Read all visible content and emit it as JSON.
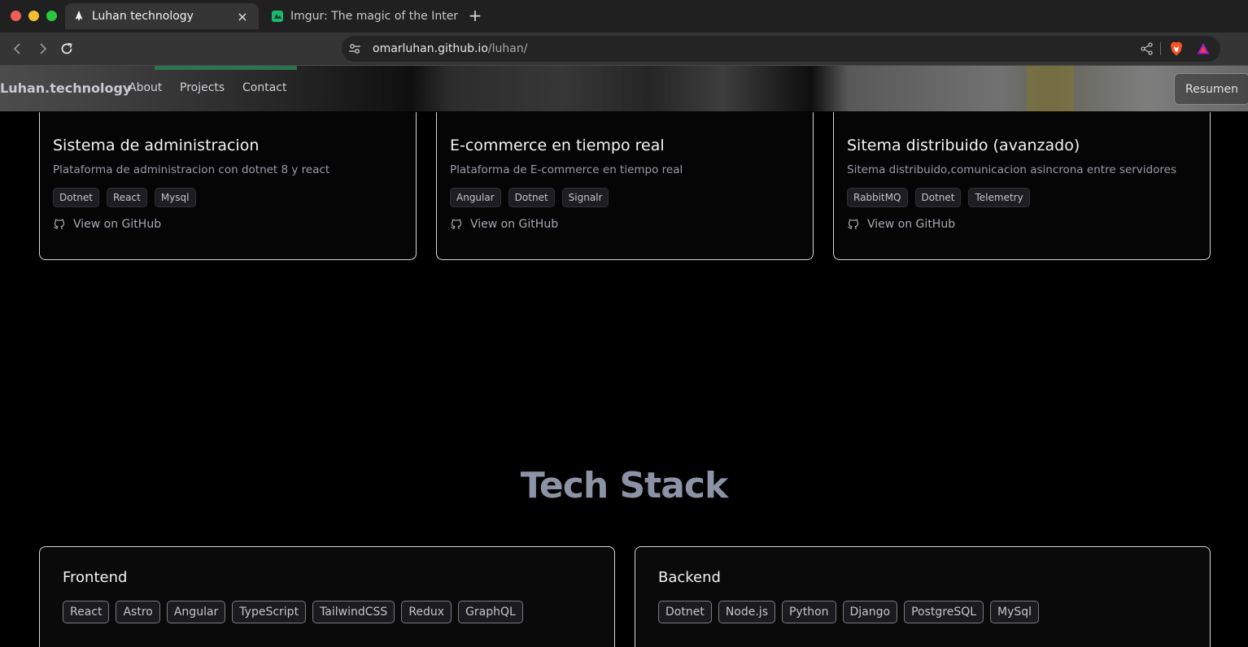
{
  "browser": {
    "tabs": [
      {
        "title": "Luhan technology",
        "active": true
      },
      {
        "title": "Imgur: The magic of the Inter",
        "active": false
      }
    ],
    "close_glyph": "×",
    "newtab_glyph": "+",
    "url_domain": "omarluhan.github.io",
    "url_path": "/luhan/"
  },
  "header": {
    "brand": "Luhan.technology",
    "nav": [
      "About",
      "Projects",
      "Contact"
    ],
    "resume_label": "Resumen"
  },
  "projects": [
    {
      "title": "Sistema de administracion",
      "description": "Plataforma de administracion con dotnet 8 y react",
      "tags": [
        "Dotnet",
        "React",
        "Mysql"
      ],
      "link": "View on GitHub"
    },
    {
      "title": "E-commerce en tiempo real",
      "description": "Plataforma de E-commerce en tiempo real",
      "tags": [
        "Angular",
        "Dotnet",
        "Signalr"
      ],
      "link": "View on GitHub"
    },
    {
      "title": "Sitema distribuido (avanzado)",
      "description": "Sitema distribuido,comunicacion asincrona entre servidores",
      "tags": [
        "RabbitMQ",
        "Dotnet",
        "Telemetry"
      ],
      "link": "View on GitHub"
    }
  ],
  "tech_stack": {
    "heading": "Tech Stack",
    "frontend": {
      "title": "Frontend",
      "items": [
        "React",
        "Astro",
        "Angular",
        "TypeScript",
        "TailwindCSS",
        "Redux",
        "GraphQL"
      ]
    },
    "backend": {
      "title": "Backend",
      "items": [
        "Dotnet",
        "Node.js",
        "Python",
        "Django",
        "PostgreSQL",
        "MySql"
      ]
    }
  },
  "icons": {
    "back": "chevron-left-icon",
    "forward": "chevron-right-icon",
    "reload": "reload-icon",
    "site_settings": "tune-icon",
    "share": "share-icon",
    "brave": "brave-shield-icon",
    "rewards": "brave-rewards-icon",
    "github": "github-icon"
  },
  "colors": {
    "page_bg": "#000000",
    "card_border": "#d6d6d6",
    "heading_accent": "#8c93a6"
  }
}
